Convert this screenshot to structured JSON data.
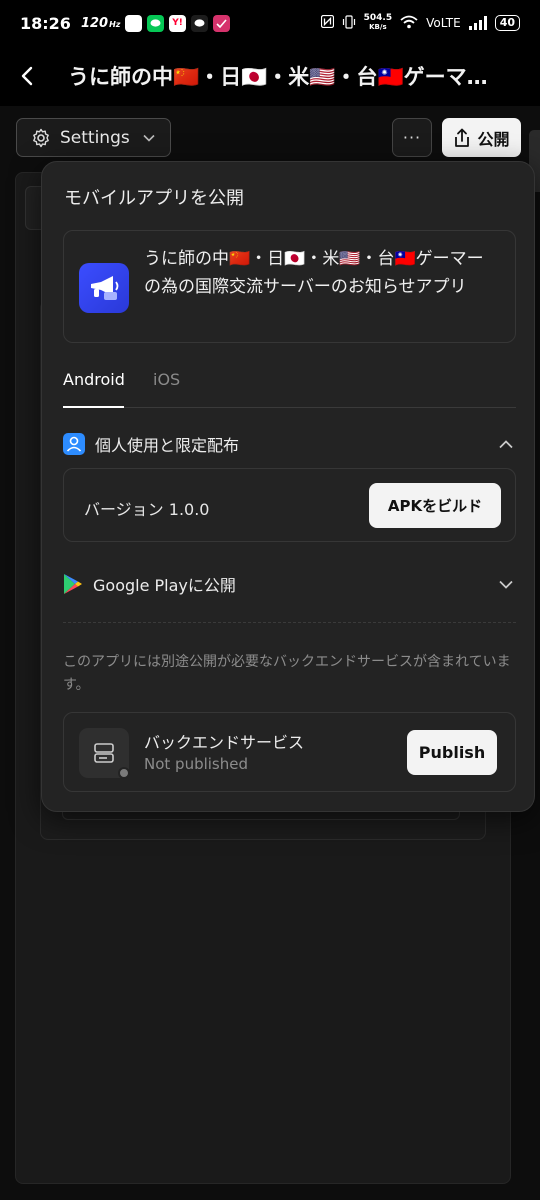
{
  "status_bar": {
    "time": "18:26",
    "refresh_rate": "120",
    "refresh_unit": "Hz",
    "speed_value": "504.5",
    "speed_unit": "KB/s",
    "network": "VoLTE",
    "battery": "40",
    "app_icons": [
      "generic-app-icon",
      "line-icon",
      "yahoo-icon",
      "chat-icon",
      "check-app-icon"
    ]
  },
  "header": {
    "title": "うに師の中🇨🇳・日🇯🇵・米🇺🇸・台🇹🇼ゲーマ…"
  },
  "toolbar": {
    "settings_label": "Settings",
    "more_label": "···",
    "publish_label": "公開"
  },
  "popover": {
    "title": "モバイルアプリを公開",
    "app_name": "うに師の中🇨🇳・日🇯🇵・米🇺🇸・台🇹🇼ゲーマーの為の国際交流サーバーのお知らせアプリ",
    "tabs": [
      {
        "label": "Android",
        "active": true
      },
      {
        "label": "iOS",
        "active": false
      }
    ],
    "personal_section": {
      "title": "個人使用と限定配布",
      "version_label": "バージョン 1.0.0",
      "build_button": "APKをビルド"
    },
    "google_play_section": {
      "title": "Google Playに公開"
    },
    "note": "このアプリには別途公開が必要なバックエンドサービスが含まれています。",
    "backend": {
      "name": "バックエンドサービス",
      "status": "Not published",
      "publish_button": "Publish"
    }
  },
  "colors": {
    "background": "#0d0d0d",
    "popover": "#232323",
    "button_light": "#f3f3f3",
    "app_icon_blue": "#3b4dff",
    "person_icon_blue": "#2d8cff"
  }
}
